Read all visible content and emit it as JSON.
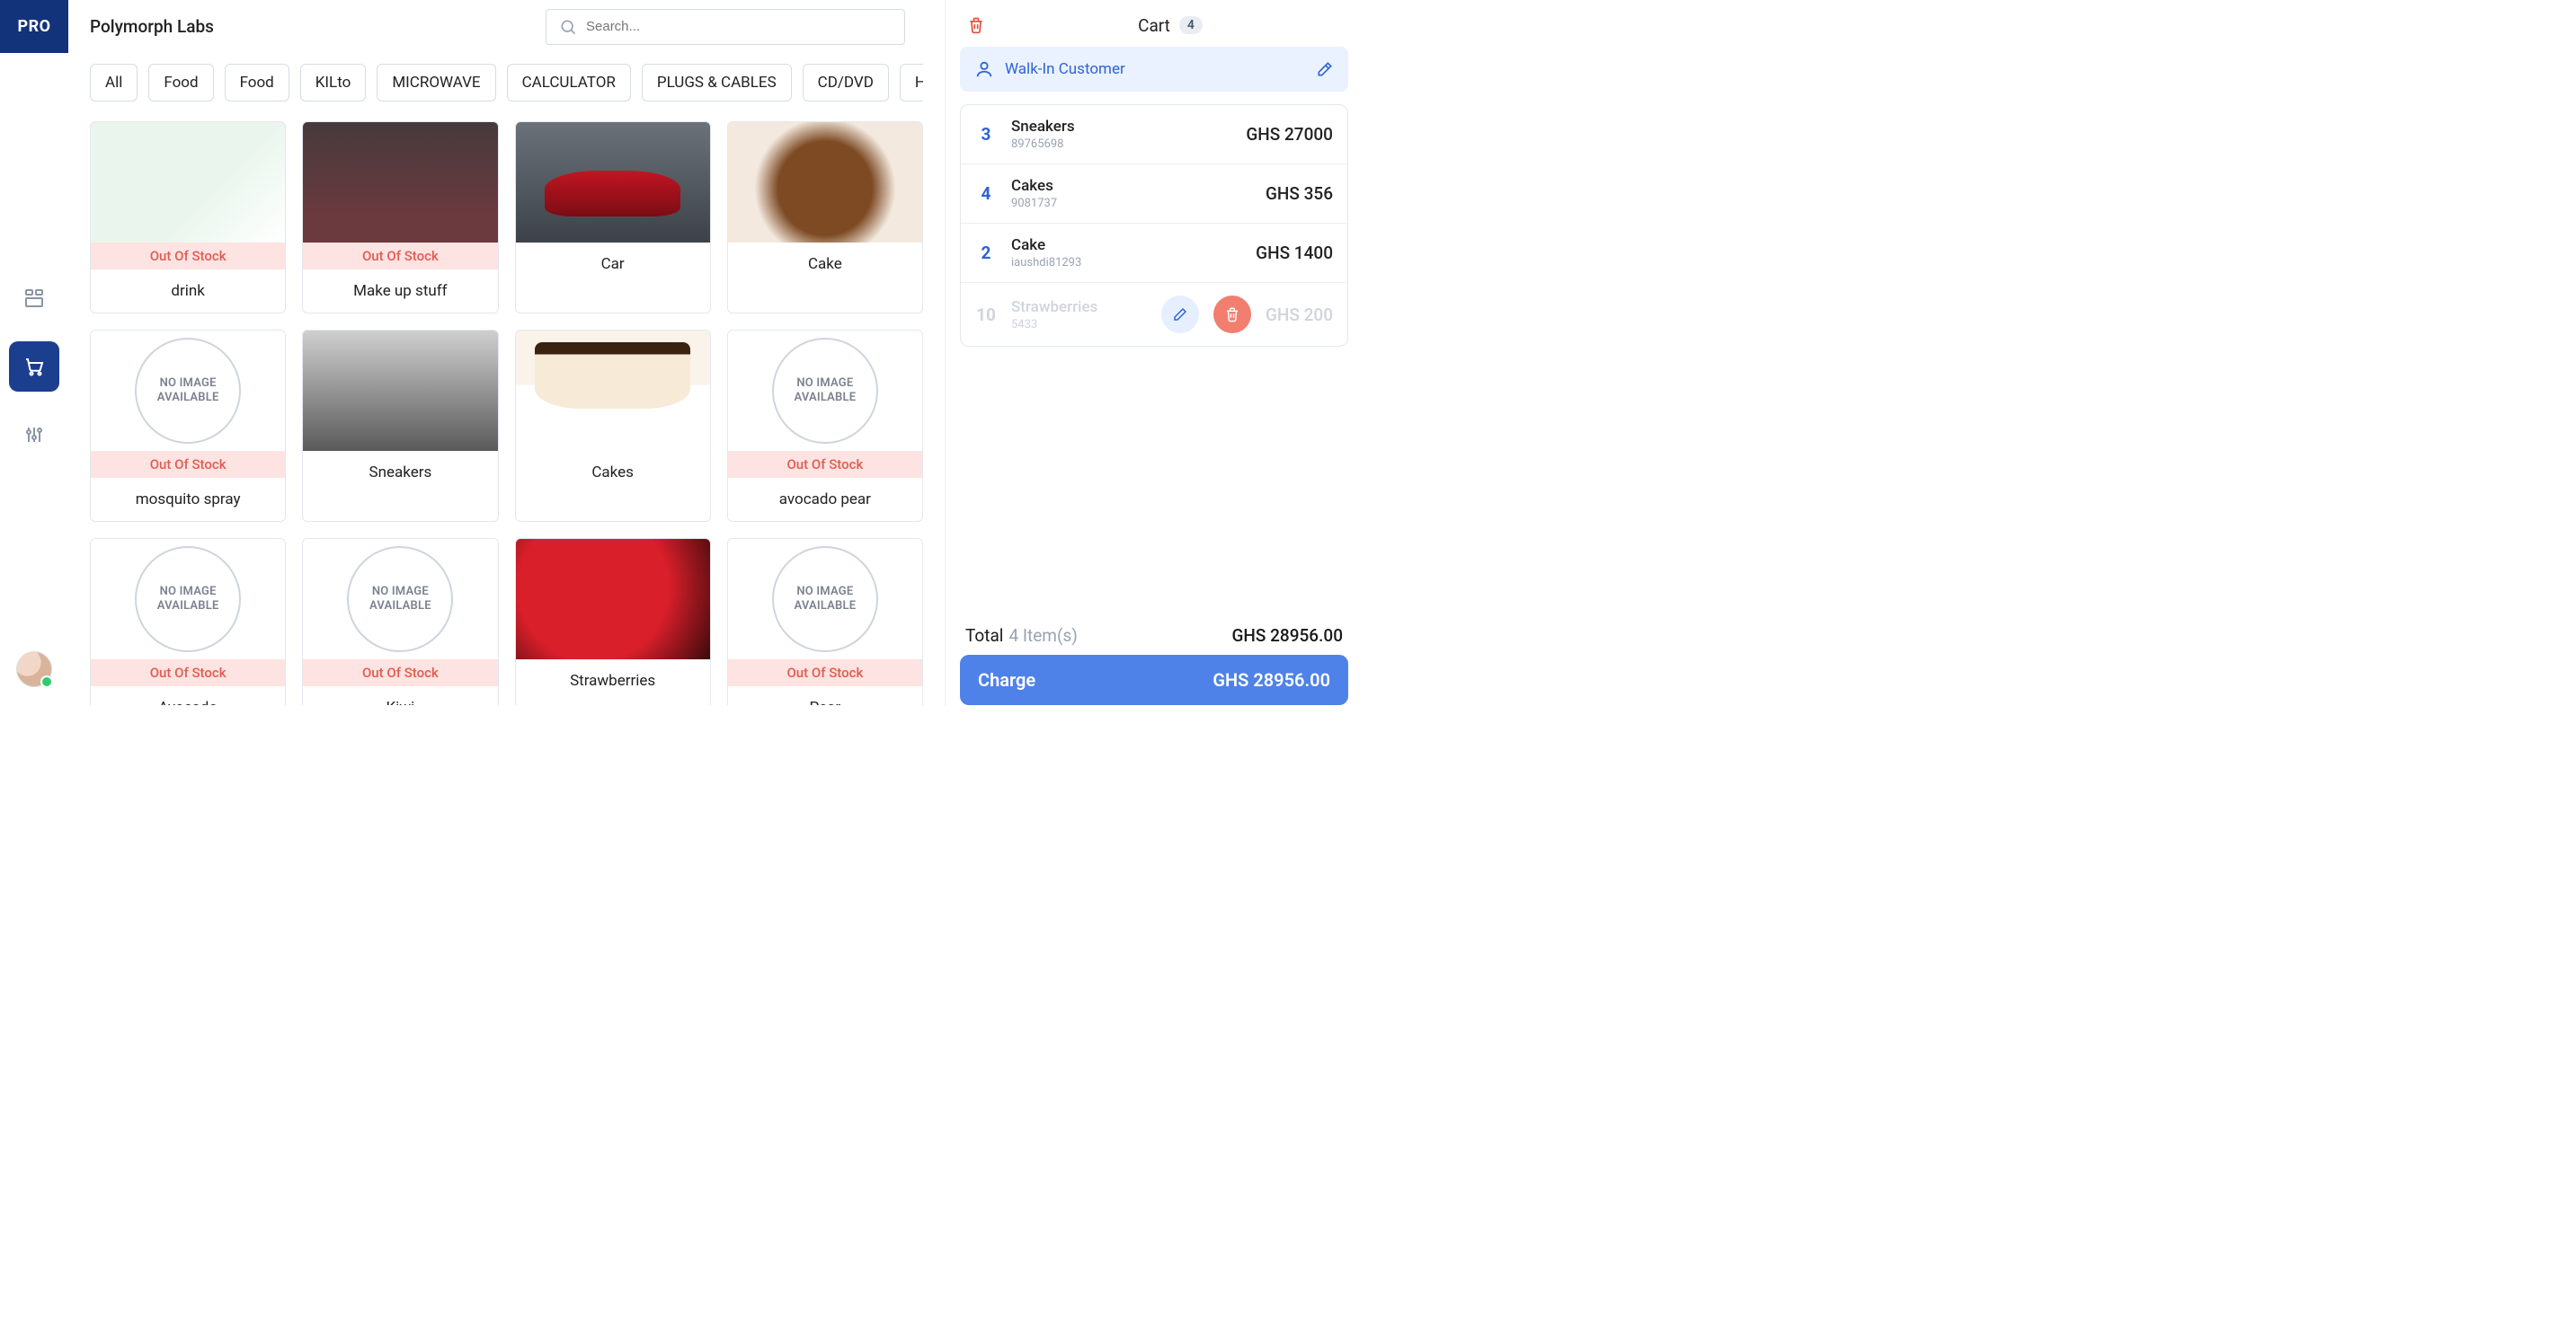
{
  "logo_text": "PRO",
  "brand": "Polymorph Labs",
  "search_placeholder": "Search...",
  "categories": [
    "All",
    "Food",
    "Food",
    "KILto",
    "MICROWAVE",
    "CALCULATOR",
    "PLUGS & CABLES",
    "CD/DVD",
    "HEALTH & FITNESS"
  ],
  "oos_label": "Out Of Stock",
  "noimg_line1": "NO IMAGE",
  "noimg_line2": "AVAILABLE",
  "products": [
    {
      "name": "drink",
      "image": "chart",
      "out_of_stock": true
    },
    {
      "name": "Make up stuff",
      "image": "makeup",
      "out_of_stock": true
    },
    {
      "name": "Car",
      "image": "car",
      "out_of_stock": false
    },
    {
      "name": "Cake",
      "image": "cake1",
      "out_of_stock": false
    },
    {
      "name": "mosquito spray",
      "image": "none",
      "out_of_stock": true
    },
    {
      "name": "Sneakers",
      "image": "sneaker",
      "out_of_stock": false
    },
    {
      "name": "Cakes",
      "image": "cake2",
      "out_of_stock": false
    },
    {
      "name": "avocado pear",
      "image": "none",
      "out_of_stock": true
    },
    {
      "name": "Avocado",
      "image": "none",
      "out_of_stock": true
    },
    {
      "name": "Kiwi",
      "image": "none",
      "out_of_stock": true
    },
    {
      "name": "Strawberries",
      "image": "straw",
      "out_of_stock": false
    },
    {
      "name": "Pear",
      "image": "none",
      "out_of_stock": true
    }
  ],
  "cart": {
    "title": "Cart",
    "count": "4",
    "customer_label": "Walk-In Customer",
    "items": [
      {
        "qty": "3",
        "name": "Sneakers",
        "sku": "89765698",
        "price": "GHS 27000",
        "ghost": false
      },
      {
        "qty": "4",
        "name": "Cakes",
        "sku": "9081737",
        "price": "GHS 356",
        "ghost": false
      },
      {
        "qty": "2",
        "name": "Cake",
        "sku": "iaushdi81293",
        "price": "GHS 1400",
        "ghost": false
      },
      {
        "qty": "10",
        "name": "Strawberries",
        "sku": "5433",
        "price": "GHS 200",
        "ghost": true
      }
    ],
    "total_label": "Total",
    "total_count_label": "4 Item(s)",
    "total_amount": "GHS 28956.00",
    "charge_label": "Charge",
    "charge_amount": "GHS 28956.00"
  }
}
